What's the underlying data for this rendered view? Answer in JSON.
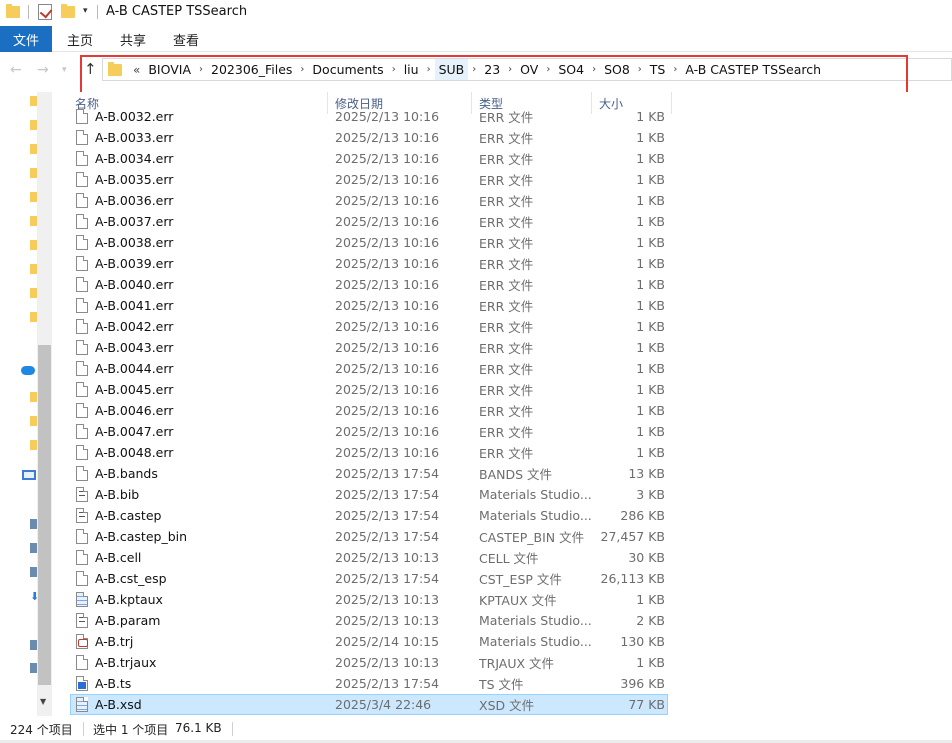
{
  "window": {
    "title": "A-B CASTEP TSSearch"
  },
  "ribbon": {
    "file_tab": "文件",
    "tabs": [
      "主页",
      "共享",
      "查看"
    ]
  },
  "address_bar": {
    "overflow": "«",
    "crumbs": [
      "BIOVIA",
      "202306_Files",
      "Documents",
      "liu",
      "SUB",
      "23",
      "OV",
      "SO4",
      "SO8",
      "TS",
      "A-B CASTEP TSSearch"
    ],
    "separator": "›",
    "highlighted_crumb": "SUB"
  },
  "highlight_color": "#e53935",
  "columns": {
    "name": "名称",
    "date": "修改日期",
    "type": "类型",
    "size": "大小"
  },
  "files": [
    {
      "name": "A-B.0032.err",
      "date": "2025/2/13 10:16",
      "type": "ERR 文件",
      "size": "1 KB",
      "icon": "file-icon"
    },
    {
      "name": "A-B.0033.err",
      "date": "2025/2/13 10:16",
      "type": "ERR 文件",
      "size": "1 KB",
      "icon": "file-icon"
    },
    {
      "name": "A-B.0034.err",
      "date": "2025/2/13 10:16",
      "type": "ERR 文件",
      "size": "1 KB",
      "icon": "file-icon"
    },
    {
      "name": "A-B.0035.err",
      "date": "2025/2/13 10:16",
      "type": "ERR 文件",
      "size": "1 KB",
      "icon": "file-icon"
    },
    {
      "name": "A-B.0036.err",
      "date": "2025/2/13 10:16",
      "type": "ERR 文件",
      "size": "1 KB",
      "icon": "file-icon"
    },
    {
      "name": "A-B.0037.err",
      "date": "2025/2/13 10:16",
      "type": "ERR 文件",
      "size": "1 KB",
      "icon": "file-icon"
    },
    {
      "name": "A-B.0038.err",
      "date": "2025/2/13 10:16",
      "type": "ERR 文件",
      "size": "1 KB",
      "icon": "file-icon"
    },
    {
      "name": "A-B.0039.err",
      "date": "2025/2/13 10:16",
      "type": "ERR 文件",
      "size": "1 KB",
      "icon": "file-icon"
    },
    {
      "name": "A-B.0040.err",
      "date": "2025/2/13 10:16",
      "type": "ERR 文件",
      "size": "1 KB",
      "icon": "file-icon"
    },
    {
      "name": "A-B.0041.err",
      "date": "2025/2/13 10:16",
      "type": "ERR 文件",
      "size": "1 KB",
      "icon": "file-icon"
    },
    {
      "name": "A-B.0042.err",
      "date": "2025/2/13 10:16",
      "type": "ERR 文件",
      "size": "1 KB",
      "icon": "file-icon"
    },
    {
      "name": "A-B.0043.err",
      "date": "2025/2/13 10:16",
      "type": "ERR 文件",
      "size": "1 KB",
      "icon": "file-icon"
    },
    {
      "name": "A-B.0044.err",
      "date": "2025/2/13 10:16",
      "type": "ERR 文件",
      "size": "1 KB",
      "icon": "file-icon"
    },
    {
      "name": "A-B.0045.err",
      "date": "2025/2/13 10:16",
      "type": "ERR 文件",
      "size": "1 KB",
      "icon": "file-icon"
    },
    {
      "name": "A-B.0046.err",
      "date": "2025/2/13 10:16",
      "type": "ERR 文件",
      "size": "1 KB",
      "icon": "file-icon"
    },
    {
      "name": "A-B.0047.err",
      "date": "2025/2/13 10:16",
      "type": "ERR 文件",
      "size": "1 KB",
      "icon": "file-icon"
    },
    {
      "name": "A-B.0048.err",
      "date": "2025/2/13 10:16",
      "type": "ERR 文件",
      "size": "1 KB",
      "icon": "file-icon"
    },
    {
      "name": "A-B.bands",
      "date": "2025/2/13 17:54",
      "type": "BANDS 文件",
      "size": "13 KB",
      "icon": "file-icon"
    },
    {
      "name": "A-B.bib",
      "date": "2025/2/13 17:54",
      "type": "Materials Studio...",
      "size": "3 KB",
      "icon": "text-file-icon"
    },
    {
      "name": "A-B.castep",
      "date": "2025/2/13 17:54",
      "type": "Materials Studio...",
      "size": "286 KB",
      "icon": "text-file-icon"
    },
    {
      "name": "A-B.castep_bin",
      "date": "2025/2/13 17:54",
      "type": "CASTEP_BIN 文件",
      "size": "27,457 KB",
      "icon": "file-icon"
    },
    {
      "name": "A-B.cell",
      "date": "2025/2/13 10:13",
      "type": "CELL 文件",
      "size": "30 KB",
      "icon": "file-icon"
    },
    {
      "name": "A-B.cst_esp",
      "date": "2025/2/13 17:54",
      "type": "CST_ESP 文件",
      "size": "26,113 KB",
      "icon": "file-icon"
    },
    {
      "name": "A-B.kptaux",
      "date": "2025/2/13 10:13",
      "type": "KPTAUX 文件",
      "size": "1 KB",
      "icon": "xsd-file-icon"
    },
    {
      "name": "A-B.param",
      "date": "2025/2/13 10:13",
      "type": "Materials Studio...",
      "size": "2 KB",
      "icon": "text-file-icon"
    },
    {
      "name": "A-B.trj",
      "date": "2025/2/14 10:15",
      "type": "Materials Studio...",
      "size": "130 KB",
      "icon": "trj-file-icon"
    },
    {
      "name": "A-B.trjaux",
      "date": "2025/2/13 10:13",
      "type": "TRJAUX 文件",
      "size": "1 KB",
      "icon": "file-icon"
    },
    {
      "name": "A-B.ts",
      "date": "2025/2/13 17:54",
      "type": "TS 文件",
      "size": "396 KB",
      "icon": "ts-file-icon"
    },
    {
      "name": "A-B.xsd",
      "date": "2025/3/4 22:46",
      "type": "XSD 文件",
      "size": "77 KB",
      "icon": "xsd-file-icon",
      "selected": true
    }
  ],
  "status": {
    "count": "224 个项目",
    "selection": "选中 1 个项目",
    "selection_size": "76.1 KB"
  }
}
